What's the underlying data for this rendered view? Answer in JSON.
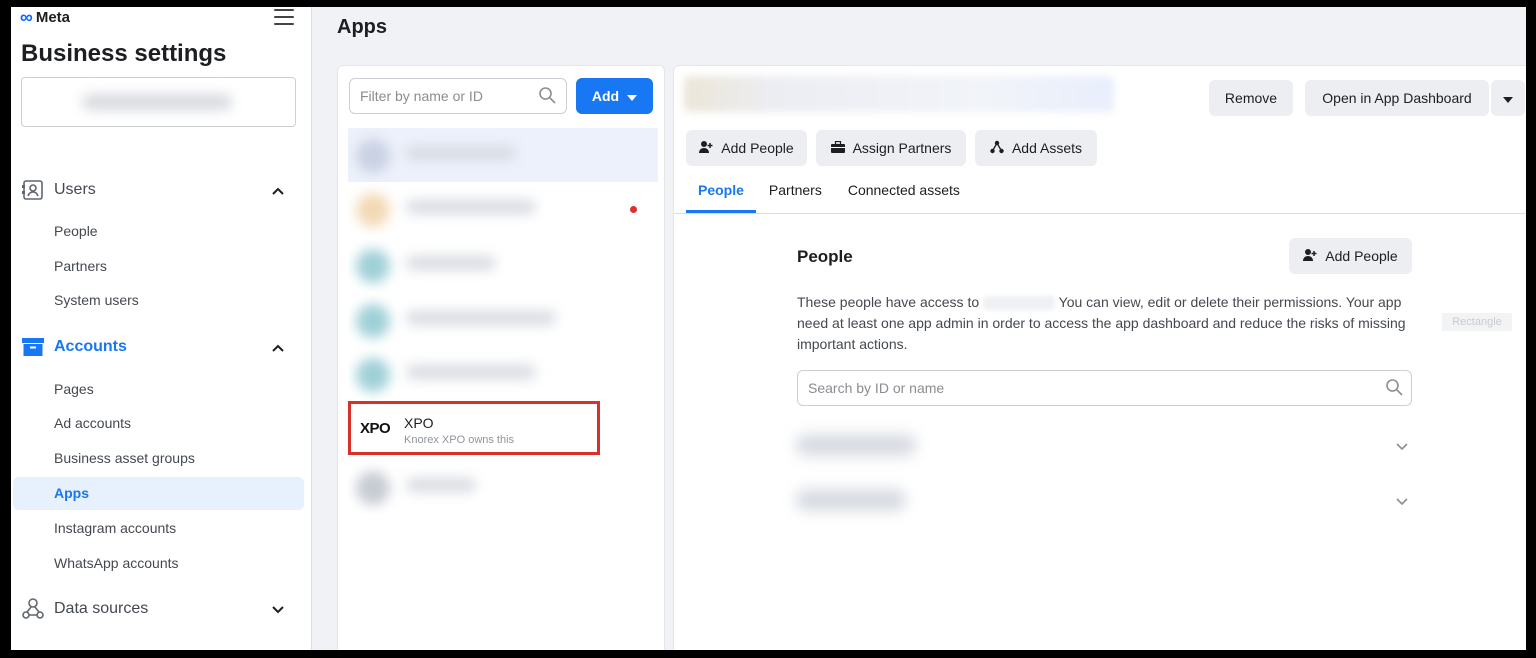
{
  "brand": {
    "name": "Meta"
  },
  "sidebar": {
    "title": "Business settings",
    "sections": {
      "users": {
        "label": "Users"
      },
      "accounts": {
        "label": "Accounts"
      },
      "data_sources": {
        "label": "Data sources"
      }
    },
    "users_items": [
      "People",
      "Partners",
      "System users"
    ],
    "accounts_items": [
      "Pages",
      "Ad accounts",
      "Business asset groups",
      "Apps",
      "Instagram accounts",
      "WhatsApp accounts"
    ],
    "active_item": "Apps"
  },
  "main": {
    "title": "Apps",
    "filter_placeholder": "Filter by name or ID",
    "add_label": "Add",
    "highlighted_app": {
      "name": "XPO",
      "owner_text": "Knorex XPO owns this",
      "logo_text": "XPO"
    }
  },
  "detail": {
    "remove_label": "Remove",
    "open_dashboard_label": "Open in App Dashboard",
    "actions": {
      "add_people": "Add People",
      "assign_partners": "Assign Partners",
      "add_assets": "Add Assets"
    },
    "tabs": [
      "People",
      "Partners",
      "Connected assets"
    ],
    "active_tab": "People",
    "people": {
      "title": "People",
      "add_label": "Add People",
      "desc_before": "These people have access to",
      "desc_after": "You can view, edit or delete their permissions. Your app need at least one app admin in order to access the app dashboard and reduce the risks of missing important actions.",
      "search_placeholder": "Search by ID or name"
    }
  },
  "overlay_tag": "Rectangle",
  "colors": {
    "accent": "#1877f2",
    "highlight_border": "#d9302a"
  }
}
